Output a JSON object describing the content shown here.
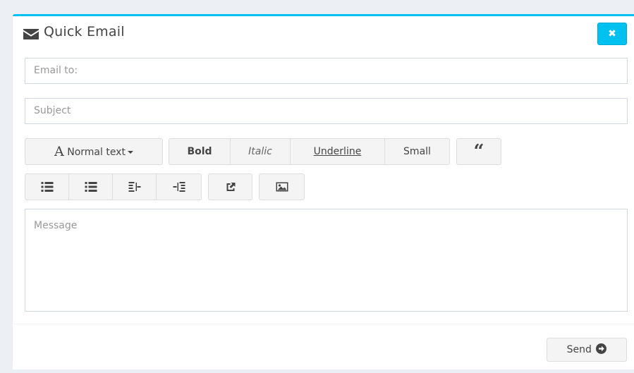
{
  "header": {
    "title": "Quick Email",
    "icon": "envelope-icon",
    "close_label": "✖"
  },
  "form": {
    "email_placeholder": "Email to:",
    "subject_placeholder": "Subject",
    "message_placeholder": "Message"
  },
  "toolbar": {
    "format_letter": "A",
    "format_label": "Normal text",
    "bold_label": "Bold",
    "italic_label": "Italic",
    "underline_label": "Underline",
    "small_label": "Small",
    "quote_label": "“",
    "icons": [
      "unordered-list-icon",
      "ordered-list-icon",
      "outdent-icon",
      "indent-icon",
      "link-icon",
      "image-icon"
    ]
  },
  "footer": {
    "send_label": "Send"
  },
  "colors": {
    "accent": "#00c0ef",
    "background": "#ecf0f5",
    "button_bg": "#f4f4f4",
    "border": "#d2d6de"
  }
}
